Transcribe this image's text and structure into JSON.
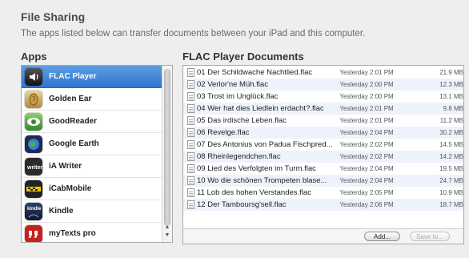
{
  "header": {
    "title": "File Sharing",
    "subtitle": "The apps listed below can transfer documents between your iPad and this computer."
  },
  "apps": {
    "header": "Apps",
    "items": [
      {
        "label": "FLAC Player",
        "icon": "flac-player-icon",
        "selected": true
      },
      {
        "label": "Golden Ear",
        "icon": "golden-ear-icon",
        "selected": false
      },
      {
        "label": "GoodReader",
        "icon": "goodreader-icon",
        "selected": false
      },
      {
        "label": "Google Earth",
        "icon": "google-earth-icon",
        "selected": false
      },
      {
        "label": "iA Writer",
        "icon": "ia-writer-icon",
        "selected": false
      },
      {
        "label": "iCabMobile",
        "icon": "icabmobile-icon",
        "selected": false
      },
      {
        "label": "Kindle",
        "icon": "kindle-icon",
        "selected": false
      },
      {
        "label": "myTexts pro",
        "icon": "mytexts-pro-icon",
        "selected": false
      }
    ]
  },
  "documents": {
    "header": "FLAC Player Documents",
    "items": [
      {
        "name": "01 Der Schildwache Nachtlied.flac",
        "date": "Yesterday 2:01 PM",
        "size": "21.9 MB"
      },
      {
        "name": "02 Verlor'ne Müh.flac",
        "date": "Yesterday 2:00 PM",
        "size": "12.3 MB"
      },
      {
        "name": "03 Trost im Unglück.flac",
        "date": "Yesterday 2:00 PM",
        "size": "13.1 MB"
      },
      {
        "name": "04 Wer hat dies Liedlein erdacht?.flac",
        "date": "Yesterday 2:01 PM",
        "size": "9.8 MB"
      },
      {
        "name": "05 Das irdische Leben.flac",
        "date": "Yesterday 2:01 PM",
        "size": "11.2 MB"
      },
      {
        "name": "06 Revelge.flac",
        "date": "Yesterday 2:04 PM",
        "size": "30.2 MB"
      },
      {
        "name": "07 Des Antonius von Padua Fischpred...",
        "date": "Yesterday 2:02 PM",
        "size": "14.5 MB"
      },
      {
        "name": "08 Rheinlegendchen.flac",
        "date": "Yesterday 2:02 PM",
        "size": "14.2 MB"
      },
      {
        "name": "09 Lied des Verfolgten im Turm.flac",
        "date": "Yesterday 2:04 PM",
        "size": "19.5 MB"
      },
      {
        "name": "10 Wo die schönen Trompeten blase...",
        "date": "Yesterday 2:04 PM",
        "size": "24.7 MB"
      },
      {
        "name": "11 Lob des hohen Verstandes.flac",
        "date": "Yesterday 2:05 PM",
        "size": "10.9 MB"
      },
      {
        "name": "12 Der Tamboursg'sell.flac",
        "date": "Yesterday 2:06 PM",
        "size": "18.7 MB"
      }
    ],
    "add_label": "Add...",
    "save_label": "Save to..."
  }
}
